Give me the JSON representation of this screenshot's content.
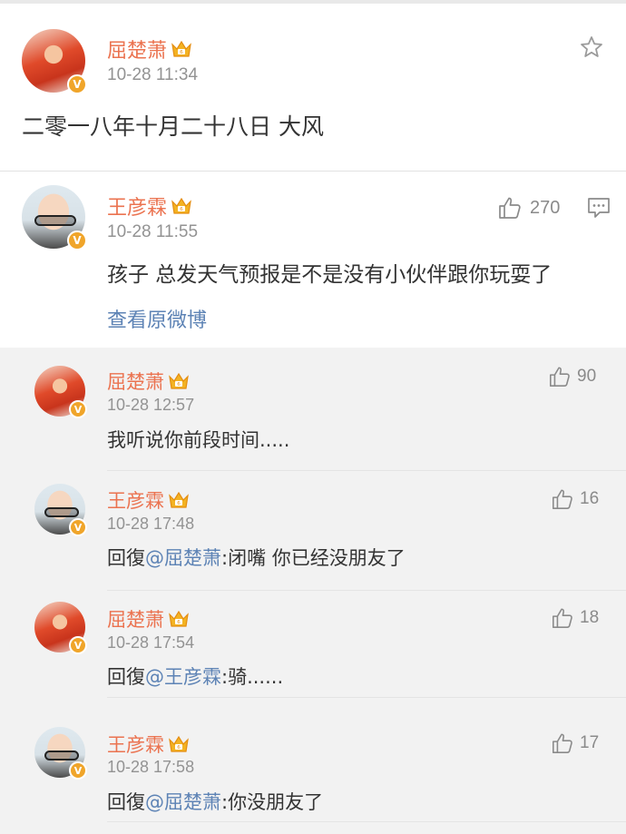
{
  "post": {
    "author": "屈楚萧",
    "time": "10-28 11:34",
    "text": "二零一八年十月二十八日 大风"
  },
  "top_comment": {
    "author": "王彦霖",
    "time": "10-28 11:55",
    "text": "孩子 总发天气预报是不是没有小伙伴跟你玩耍了",
    "likes": "270",
    "view_original": "查看原微博"
  },
  "replies": [
    {
      "author": "屈楚萧",
      "time": "10-28 12:57",
      "likes": "90",
      "text": "我听说你前段时间.....",
      "prefix": "",
      "mention": "",
      "rest": ""
    },
    {
      "author": "王彦霖",
      "time": "10-28 17:48",
      "likes": "16",
      "text": "",
      "prefix": "回復",
      "mention": "@屈楚萧",
      "rest": ":闭嘴 你已经没朋友了"
    },
    {
      "author": "屈楚萧",
      "time": "10-28 17:54",
      "likes": "18",
      "text": "",
      "prefix": "回復",
      "mention": "@王彦霖",
      "rest": ":骑......"
    },
    {
      "author": "王彦霖",
      "time": "10-28 17:58",
      "likes": "17",
      "text": "",
      "prefix": "回復",
      "mention": "@屈楚萧",
      "rest": ":你没朋友了"
    }
  ],
  "icons": {
    "verified_badge": "V",
    "star": "star-icon",
    "like": "thumbs-up-icon",
    "comment": "comment-icon",
    "crown": "crown-badge-icon"
  },
  "colors": {
    "name": "#eb7350",
    "link": "#5d83b5",
    "time": "#939393",
    "badge": "#f0a52a"
  }
}
